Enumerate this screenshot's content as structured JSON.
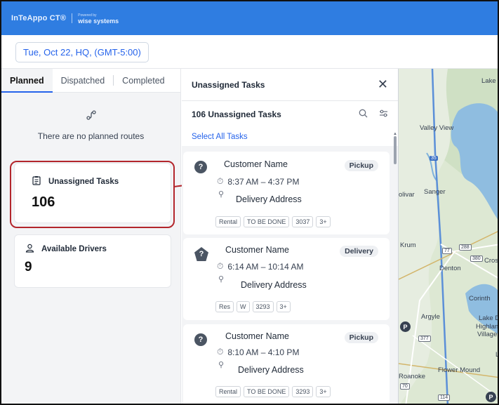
{
  "header": {
    "logo": "InTeAppo CT®",
    "powered_small": "Powered by",
    "powered_brand": "wise systems"
  },
  "datebar": {
    "date_label": "Tue, Oct 22, HQ, (GMT-5:00)"
  },
  "tabs": [
    {
      "label": "Planned",
      "active": true
    },
    {
      "label": "Dispatched",
      "active": false
    },
    {
      "label": "Completed",
      "active": false
    }
  ],
  "planned": {
    "empty_text": "There are no planned routes"
  },
  "unassigned_card": {
    "label": "Unassigned Tasks",
    "count": "106"
  },
  "drivers_card": {
    "label": "Available Drivers",
    "count": "9"
  },
  "task_panel": {
    "title": "Unassigned Tasks",
    "count_label": "106 Unassigned Tasks",
    "select_all": "Select All Tasks"
  },
  "tasks": [
    {
      "name": "Customer Name",
      "type": "Pickup",
      "time": "8:37 AM – 4:37 PM",
      "address": "Delivery Address",
      "tags": [
        "Rental",
        "TO BE DONE",
        "3037",
        "3+"
      ]
    },
    {
      "name": "Customer Name",
      "type": "Delivery",
      "time": "6:14 AM – 10:14 AM",
      "address": "Delivery Address",
      "tags": [
        "Res",
        "W",
        "3293",
        "3+"
      ]
    },
    {
      "name": "Customer Name",
      "type": "Pickup",
      "time": "8:10 AM – 4:10 PM",
      "address": "Delivery Address",
      "tags": [
        "Rental",
        "TO BE DONE",
        "3293",
        "3+"
      ]
    }
  ],
  "map": {
    "labels": [
      "Lake",
      "Valley View",
      "Sanger",
      "olivar",
      "Krum",
      "Denton",
      "Cros",
      "Corinth",
      "Argyle",
      "Lake D",
      "Highlanc",
      "Village",
      "Flower Mound",
      "Roanoke",
      "35",
      "288",
      "380",
      "377",
      "77",
      "70",
      "114",
      "L"
    ]
  },
  "colors": {
    "accent": "#2f7de1",
    "highlight": "#b3262c",
    "link": "#2563eb"
  }
}
